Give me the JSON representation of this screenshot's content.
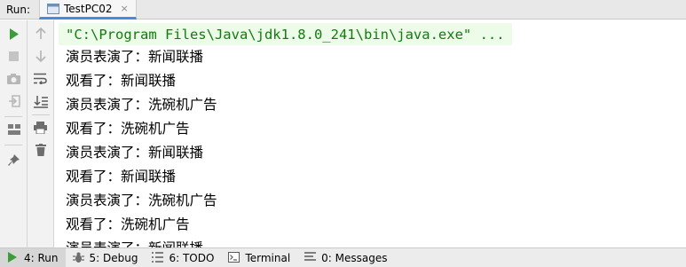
{
  "header": {
    "run_label": "Run:",
    "tab_label": "TestPC02",
    "tab_close": "×"
  },
  "console": {
    "command": "\"C:\\Program Files\\Java\\jdk1.8.0_241\\bin\\java.exe\" ...",
    "lines": [
      "演员表演了：新闻联播",
      "观看了：新闻联播",
      "演员表演了：洗碗机广告",
      "观看了：洗碗机广告",
      "演员表演了：新闻联播",
      "观看了：新闻联播",
      "演员表演了：洗碗机广告",
      "观看了：洗碗机广告",
      "演员表演了：新闻联播"
    ]
  },
  "bottom_bar": {
    "run": "4: Run",
    "debug": "5: Debug",
    "todo": "6: TODO",
    "terminal": "Terminal",
    "messages": "0: Messages"
  },
  "colors": {
    "command_text": "#127a0f",
    "command_bg": "#edfce9",
    "run_green": "#3a9d3a",
    "accent_blue": "#4a89dc"
  }
}
